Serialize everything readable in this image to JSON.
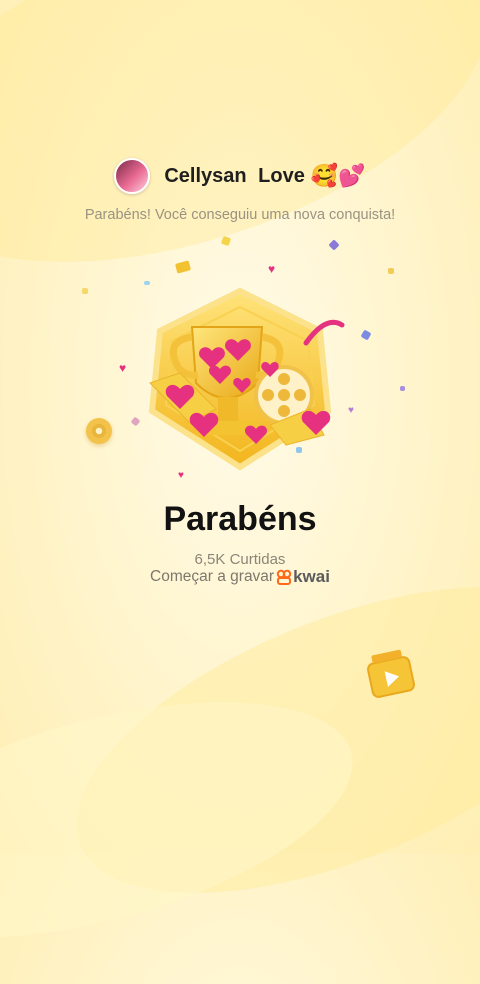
{
  "header": {
    "username": "Cellysan  Love",
    "emoji": "🥰💕"
  },
  "subtitle": "Parabéns! Você conseguiu uma nova conquista!",
  "achievement": {
    "title": "Parabéns",
    "likes": "6,5K Curtidas",
    "record_label": "Começar a gravar",
    "brand": "kwai"
  },
  "icons": [
    "avatar",
    "trophy-badge-icon",
    "film-reel-icon",
    "video-camera-icon",
    "kwai-logo-icon"
  ],
  "colors": {
    "badge_gold": "#f7c531",
    "badge_border": "#f9d760",
    "heart": "#e5317f",
    "title": "#121212",
    "subtitle": "#9a9382"
  }
}
